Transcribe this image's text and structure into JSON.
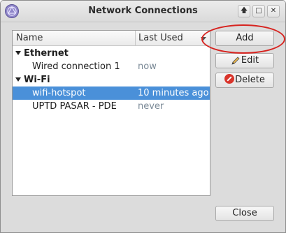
{
  "window": {
    "title": "Network Connections",
    "icon": "network-manager-icon",
    "controls": [
      "up-icon",
      "maximize-icon",
      "close-icon"
    ]
  },
  "list": {
    "columns": [
      "Name",
      "Last Used"
    ],
    "groups": [
      {
        "label": "Ethernet",
        "items": [
          {
            "name": "Wired connection 1",
            "last_used": "now",
            "selected": false
          }
        ]
      },
      {
        "label": "Wi-Fi",
        "items": [
          {
            "name": "wifi-hotspot",
            "last_used": "10 minutes ago",
            "selected": true
          },
          {
            "name": "UPTD PASAR - PDE",
            "last_used": "never",
            "selected": false
          }
        ]
      }
    ]
  },
  "buttons": {
    "add": "Add",
    "edit": "Edit",
    "delete": "Delete",
    "close": "Close"
  },
  "colors": {
    "selection": "#4a90d9",
    "annotation": "#d7231f",
    "time_text": "#7a8996"
  }
}
